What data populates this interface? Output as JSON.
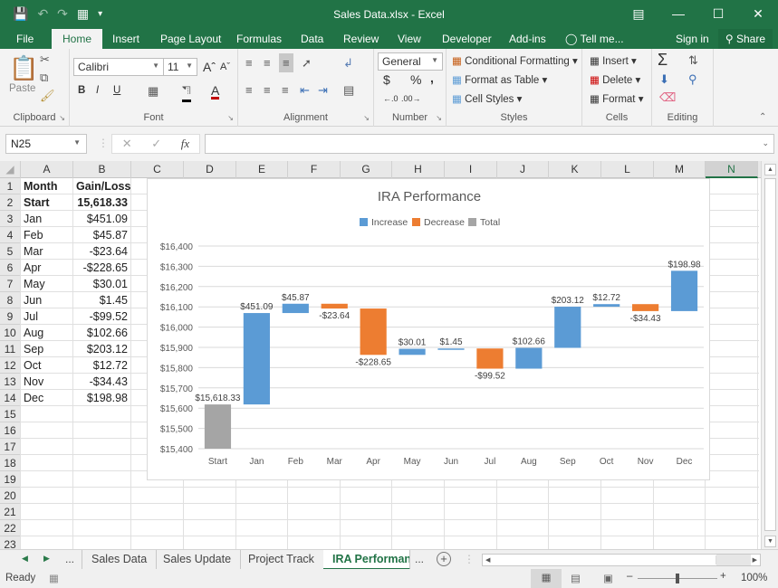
{
  "window": {
    "title": "Sales Data.xlsx - Excel",
    "controls": [
      "ribbon-display-icon",
      "minimize-icon",
      "maximize-icon",
      "close-icon"
    ]
  },
  "qat": {
    "icons": [
      "save-icon",
      "undo-icon",
      "redo-icon",
      "form-icon",
      "customize-icon"
    ]
  },
  "menu_tabs": [
    "File",
    "Home",
    "Insert",
    "Page Layout",
    "Formulas",
    "Data",
    "Review",
    "View",
    "Developer",
    "Add-ins"
  ],
  "active_tab": "Home",
  "tell_me": "Tell me...",
  "sign_in": "Sign in",
  "share": "Share",
  "ribbon": {
    "clipboard": {
      "label": "Clipboard",
      "paste": "Paste"
    },
    "font": {
      "label": "Font",
      "name": "Calibri",
      "size": "11",
      "bold": "B",
      "italic": "I",
      "underline": "U",
      "font_color": "A"
    },
    "alignment": {
      "label": "Alignment"
    },
    "number": {
      "label": "Number",
      "format": "General",
      "currency": "$",
      "percent": "%",
      "comma": ","
    },
    "styles": {
      "label": "Styles",
      "conditional": "Conditional Formatting",
      "format_table": "Format as Table",
      "cell_styles": "Cell Styles"
    },
    "cells": {
      "label": "Cells",
      "insert": "Insert",
      "delete": "Delete",
      "format": "Format"
    },
    "editing": {
      "label": "Editing",
      "sum": "Σ"
    }
  },
  "formula_bar": {
    "name_box": "N25",
    "fx": "fx",
    "value": ""
  },
  "columns": [
    "A",
    "B",
    "C",
    "D",
    "E",
    "F",
    "G",
    "H",
    "I",
    "J",
    "K",
    "L",
    "M",
    "N"
  ],
  "selected_column": "N",
  "rows": [
    "1",
    "2",
    "3",
    "4",
    "5",
    "6",
    "7",
    "8",
    "9",
    "10",
    "11",
    "12",
    "13",
    "14",
    "15",
    "16",
    "17",
    "18",
    "19",
    "20",
    "21",
    "22",
    "23"
  ],
  "table": {
    "header": [
      "Month",
      "Gain/Loss"
    ],
    "rows": [
      [
        "Start",
        "15,618.33"
      ],
      [
        "Jan",
        "$451.09"
      ],
      [
        "Feb",
        "$45.87"
      ],
      [
        "Mar",
        "-$23.64"
      ],
      [
        "Apr",
        "-$228.65"
      ],
      [
        "May",
        "$30.01"
      ],
      [
        "Jun",
        "$1.45"
      ],
      [
        "Jul",
        "-$99.52"
      ],
      [
        "Aug",
        "$102.66"
      ],
      [
        "Sep",
        "$203.12"
      ],
      [
        "Oct",
        "$12.72"
      ],
      [
        "Nov",
        "-$34.43"
      ],
      [
        "Dec",
        "$198.98"
      ]
    ]
  },
  "chart_data": {
    "type": "waterfall",
    "title": "IRA Performance",
    "categories": [
      "Start",
      "Jan",
      "Feb",
      "Mar",
      "Apr",
      "May",
      "Jun",
      "Jul",
      "Aug",
      "Sep",
      "Oct",
      "Nov",
      "Dec"
    ],
    "values": [
      15618.33,
      451.09,
      45.87,
      -23.64,
      -228.65,
      30.01,
      1.45,
      -99.52,
      102.66,
      203.12,
      12.72,
      -34.43,
      198.98
    ],
    "data_labels": [
      "$15,618.33",
      "$451.09",
      "$45.87",
      "-$23.64",
      "-$228.65",
      "$30.01",
      "$1.45",
      "-$99.52",
      "$102.66",
      "$203.12",
      "$12.72",
      "-$34.43",
      "$198.98"
    ],
    "total_indices": [
      0
    ],
    "legend": [
      {
        "name": "Increase",
        "color": "#5b9bd5"
      },
      {
        "name": "Decrease",
        "color": "#ed7d31"
      },
      {
        "name": "Total",
        "color": "#a5a5a5"
      }
    ],
    "legend_position": "top",
    "ylim": [
      15400,
      16400
    ],
    "yticks": [
      15400,
      15500,
      15600,
      15700,
      15800,
      15900,
      16000,
      16100,
      16200,
      16300,
      16400
    ],
    "ytick_labels": [
      "$15,400",
      "$15,500",
      "$15,600",
      "$15,700",
      "$15,800",
      "$15,900",
      "$16,000",
      "$16,100",
      "$16,200",
      "$16,300",
      "$16,400"
    ],
    "grid": true,
    "xlabel": "",
    "ylabel": ""
  },
  "sheet_tabs": [
    "Sales Data",
    "Sales Update",
    "Project Track",
    "IRA Performanc"
  ],
  "active_sheet": "IRA Performanc",
  "sheet_nav": {
    "prev": "◀",
    "next": "▶",
    "more": "...",
    "more_right": "...",
    "add": "+"
  },
  "status": {
    "ready": "Ready",
    "zoom": "100%",
    "zoom_level": 100
  }
}
